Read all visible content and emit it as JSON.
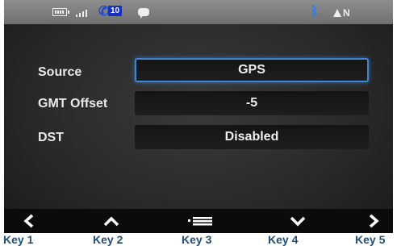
{
  "status_bar": {
    "battery_icon": "battery-icon",
    "signal_icon": "signal-bars-icon",
    "missed_calls": "10",
    "message_icon": "chat-bubble-icon",
    "bluetooth_icon": "bluetooth-icon",
    "compass_heading": "N"
  },
  "settings": [
    {
      "label": "Source",
      "value": "GPS",
      "selected": true
    },
    {
      "label": "GMT Offset",
      "value": "-5",
      "selected": false
    },
    {
      "label": "DST",
      "value": "Disabled",
      "selected": false
    }
  ],
  "keys": [
    {
      "icon": "chevron-left-icon",
      "label": "Key 1"
    },
    {
      "icon": "chevron-up-icon",
      "label": "Key 2"
    },
    {
      "icon": "menu-icon",
      "label": "Key 3"
    },
    {
      "icon": "chevron-down-icon",
      "label": "Key 4"
    },
    {
      "icon": "chevron-right-icon",
      "label": "Key 5"
    }
  ],
  "colors": {
    "accent": "#3d86d8",
    "bluetooth": "#2a7df0",
    "key_label": "#1f4e79"
  }
}
